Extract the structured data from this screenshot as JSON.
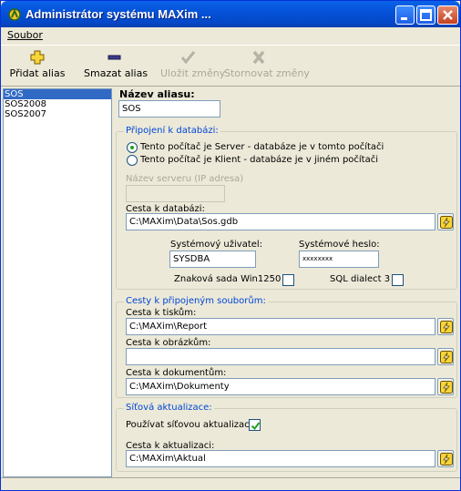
{
  "window": {
    "title": "Administrátor systému MAXim ..."
  },
  "menu": {
    "file": "Soubor"
  },
  "toolbar": {
    "add_alias": "Přidat alias",
    "remove_alias": "Smazat alias",
    "save": "Uložit změny",
    "cancel": "Stornovat změny"
  },
  "aliases": [
    "SOS",
    "SOS2008",
    "SOS2007"
  ],
  "form": {
    "alias_label": "Název aliasu:",
    "alias_value": "SOS",
    "db_group": "Připojení k databázi:",
    "radio_server": "Tento počítač je Server - databáze je v tomto počítači",
    "radio_client": "Tento počítač je Klient - databáze je v jiném počítači",
    "server_label": "Název serveru (IP adresa)",
    "server_value": "",
    "db_path_label": "Cesta k databázi:",
    "db_path_value": "C:\\MAXim\\Data\\Sos.gdb",
    "sys_user_label": "Systémový uživatel:",
    "sys_user_value": "SYSDBA",
    "sys_pass_label": "Systémové heslo:",
    "sys_pass_value": "xxxxxxxx",
    "charset_label": "Znaková sada Win1250",
    "dialect_label": "SQL dialect 3",
    "paths_group": "Cesty k připojeným souborům:",
    "print_label": "Cesta k tiskům:",
    "print_value": "C:\\MAXim\\Report",
    "images_label": "Cesta k obrázkům:",
    "images_value": "",
    "docs_label": "Cesta k dokumentům:",
    "docs_value": "C:\\MAXim\\Dokumenty",
    "net_group": "Síťová aktualizace:",
    "net_use_label": "Používat síťovou aktualizaci",
    "update_label": "Cesta k aktualizaci:",
    "update_value": "C:\\MAXim\\Aktual"
  },
  "colors": {
    "titlebar": "#0553d9",
    "selection": "#316ac5",
    "group_title": "#0046d5"
  }
}
